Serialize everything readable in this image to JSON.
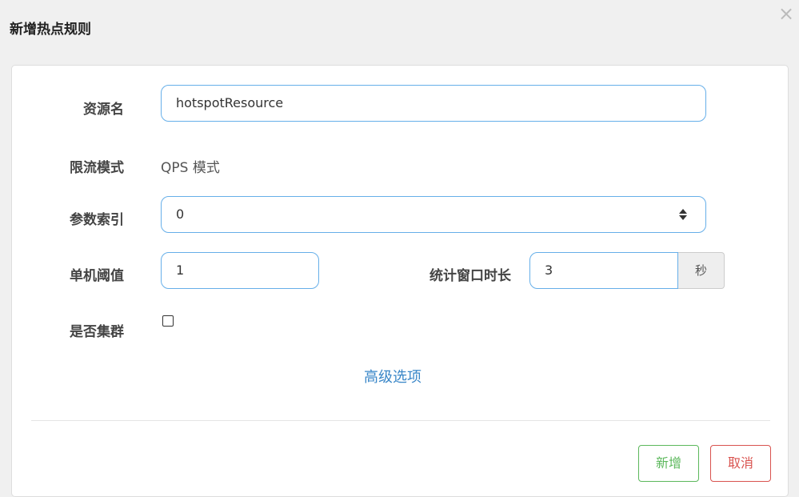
{
  "dialog": {
    "title": "新增热点规则",
    "close_icon": "close-icon"
  },
  "form": {
    "resource": {
      "label": "资源名",
      "value": "hotspotResource"
    },
    "grade": {
      "label": "限流模式",
      "value": "QPS 模式"
    },
    "param_index": {
      "label": "参数索引",
      "value": "0",
      "icon": "spinner-arrows-icon"
    },
    "threshold": {
      "label": "单机阈值",
      "value": "1"
    },
    "window": {
      "label": "统计窗口时长",
      "value": "3",
      "unit": "秒"
    },
    "cluster": {
      "label": "是否集群",
      "checked": false
    },
    "advanced_link": "高级选项"
  },
  "footer": {
    "add_label": "新增",
    "cancel_label": "取消"
  },
  "colors": {
    "input_border": "#66afe9",
    "add_button": "#5cb85c",
    "cancel_button": "#d9534f",
    "link": "#3a87c8"
  }
}
